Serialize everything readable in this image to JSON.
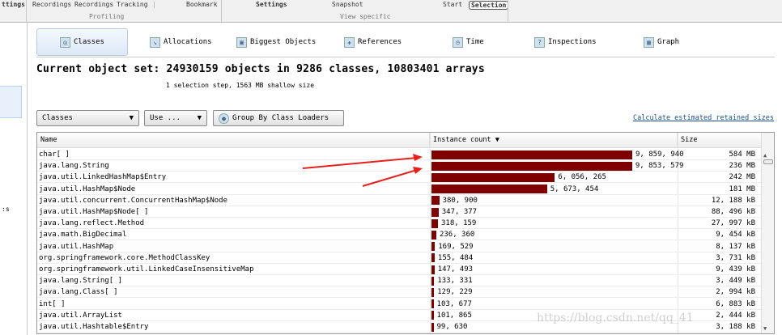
{
  "ribbon": {
    "items": [
      "ttings",
      "Recordings",
      "Recordings",
      "Tracking",
      "Bookmark",
      "Settings",
      "Snapshot",
      "Start",
      "Selection"
    ],
    "groups": [
      "Profiling",
      "View specific"
    ]
  },
  "sidebar": {
    "label": ":s"
  },
  "tabs": [
    {
      "label": "Classes",
      "icon": "classes-icon"
    },
    {
      "label": "Allocations",
      "icon": "allocations-icon"
    },
    {
      "label": "Biggest Objects",
      "icon": "biggest-objects-icon"
    },
    {
      "label": "References",
      "icon": "references-icon"
    },
    {
      "label": "Time",
      "icon": "time-icon"
    },
    {
      "label": "Inspections",
      "icon": "inspections-icon"
    },
    {
      "label": "Graph",
      "icon": "graph-icon"
    }
  ],
  "headline": "Current object set: 24930159 objects in 9286 classes, 10803401 arrays",
  "subline": "1 selection step, 1563 MB shallow size",
  "controls": {
    "view_select": "Classes",
    "use_button": "Use ...",
    "group_button": "Group By Class Loaders",
    "retained_link": "Calculate estimated retained sizes"
  },
  "table": {
    "columns": [
      "Name",
      "Instance count",
      "Size"
    ],
    "bar_color": "#800000",
    "max_count": 9859940,
    "rows": [
      {
        "name": "char[ ]",
        "count": 9859940,
        "count_text": "9, 859, 940",
        "size": "584 MB"
      },
      {
        "name": "java.lang.String",
        "count": 9853579,
        "count_text": "9, 853, 579",
        "size": "236 MB"
      },
      {
        "name": "java.util.LinkedHashMap$Entry",
        "count": 6056265,
        "count_text": "6, 056, 265",
        "size": "242 MB"
      },
      {
        "name": "java.util.HashMap$Node",
        "count": 5673454,
        "count_text": "5, 673, 454",
        "size": "181 MB"
      },
      {
        "name": "java.util.concurrent.ConcurrentHashMap$Node",
        "count": 380900,
        "count_text": "380, 900",
        "size": "12, 188 kB"
      },
      {
        "name": "java.util.HashMap$Node[ ]",
        "count": 347377,
        "count_text": "347, 377",
        "size": "88, 496 kB"
      },
      {
        "name": "java.lang.reflect.Method",
        "count": 318159,
        "count_text": "318, 159",
        "size": "27, 997 kB"
      },
      {
        "name": "java.math.BigDecimal",
        "count": 236360,
        "count_text": "236, 360",
        "size": "9, 454 kB"
      },
      {
        "name": "java.util.HashMap",
        "count": 169529,
        "count_text": "169, 529",
        "size": "8, 137 kB"
      },
      {
        "name": "org.springframework.core.MethodClassKey",
        "count": 155484,
        "count_text": "155, 484",
        "size": "3, 731 kB"
      },
      {
        "name": "org.springframework.util.LinkedCaseInsensitiveMap",
        "count": 147493,
        "count_text": "147, 493",
        "size": "9, 439 kB"
      },
      {
        "name": "java.lang.String[ ]",
        "count": 133331,
        "count_text": "133, 331",
        "size": "3, 449 kB"
      },
      {
        "name": "java.lang.Class[ ]",
        "count": 129229,
        "count_text": "129, 229",
        "size": "2, 994 kB"
      },
      {
        "name": "int[ ]",
        "count": 103677,
        "count_text": "103, 677",
        "size": "6, 883 kB"
      },
      {
        "name": "java.util.ArrayList",
        "count": 101865,
        "count_text": "101, 865",
        "size": "2, 444 kB"
      },
      {
        "name": "java.util.Hashtable$Entry",
        "count": 99630,
        "count_text": "99, 630",
        "size": "3, 188 kB"
      }
    ]
  },
  "watermark": "https://blog.csdn.net/qq_41"
}
